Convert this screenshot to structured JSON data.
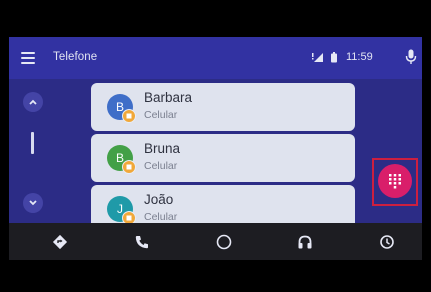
{
  "header": {
    "title": "Telefone",
    "time": "11:59"
  },
  "contacts": [
    {
      "name": "Barbara",
      "type": "Celular",
      "initial": "B",
      "color": "#3f6ec8"
    },
    {
      "name": "Bruna",
      "type": "Celular",
      "initial": "B",
      "color": "#43a047"
    },
    {
      "name": "João",
      "type": "Celular",
      "initial": "J",
      "color": "#1f9aa8"
    }
  ],
  "icons": {
    "menu": "menu-icon",
    "signal": "signal-icon",
    "battery": "battery-icon",
    "mic": "mic-icon",
    "scroll_up": "chevron-up-icon",
    "scroll_down": "chevron-down-icon",
    "dialpad": "dialpad-icon",
    "nav": [
      "navigation-icon",
      "phone-icon",
      "home-icon",
      "headphones-icon",
      "overview-icon"
    ]
  },
  "colors": {
    "background": "#2c2c86",
    "accent": "#d91e6a",
    "highlight": "#cc1f3f"
  }
}
